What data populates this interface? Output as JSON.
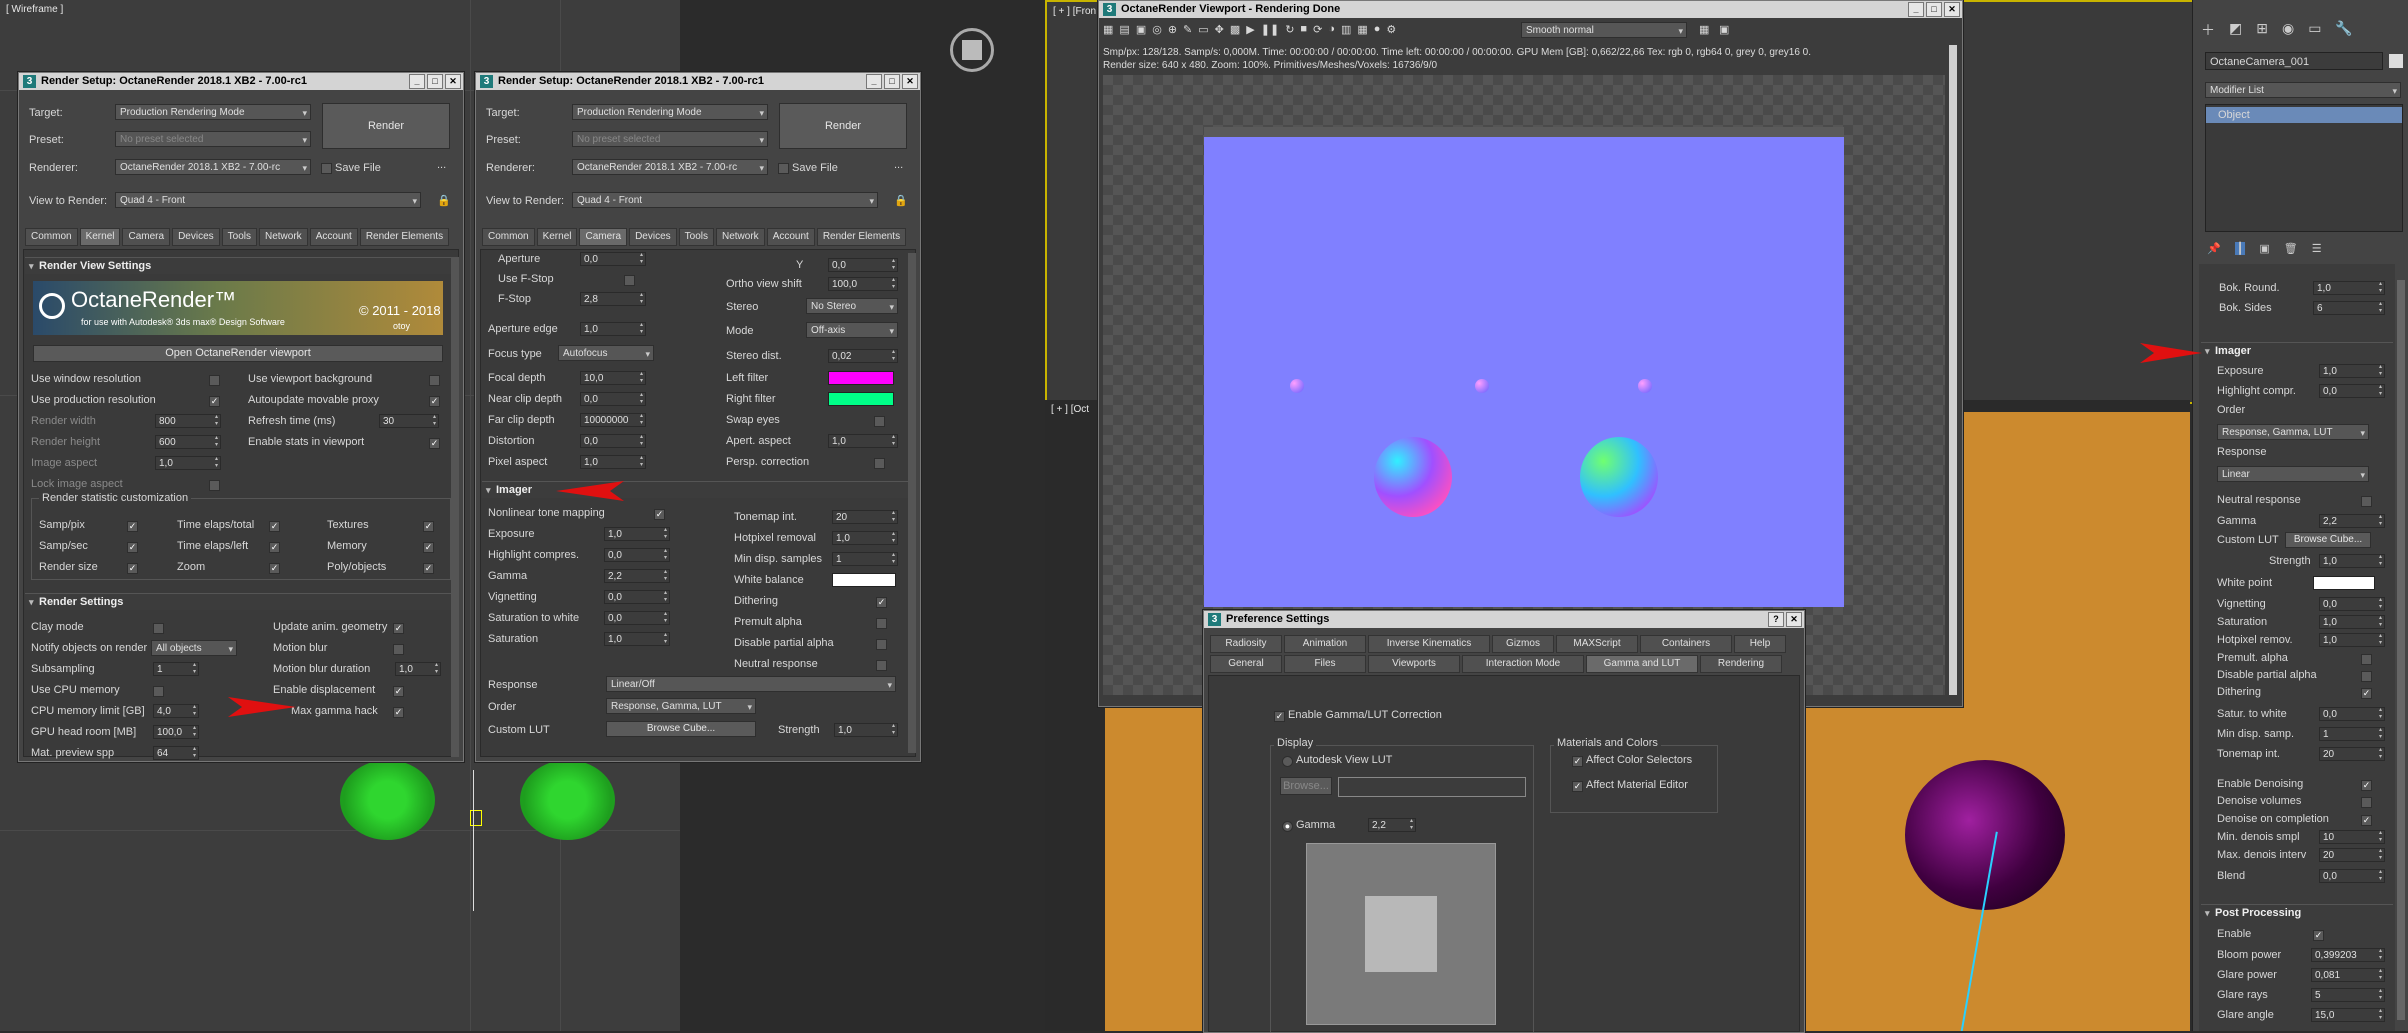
{
  "viewports": {
    "top_left_label": "[ Wireframe ]",
    "right_top_label": "[ + ] [Fron",
    "right_bottom_label": "[ + ] [Oct"
  },
  "render_setup": {
    "title": "Render Setup: OctaneRender 2018.1 XB2 - 7.00-rc1",
    "target_label": "Target:",
    "target_value": "Production Rendering Mode",
    "preset_label": "Preset:",
    "preset_value": "No preset selected",
    "renderer_label": "Renderer:",
    "renderer_value": "OctaneRender 2018.1 XB2 - 7.00-rc",
    "save_file_label": "Save File",
    "view_label": "View to Render:",
    "view_value": "Quad 4 - Front",
    "render_button": "Render",
    "ellipsis": "...",
    "tabs": [
      "Common",
      "Kernel",
      "Camera",
      "Devices",
      "Tools",
      "Network",
      "Account",
      "Render Elements"
    ]
  },
  "left_panel": {
    "render_view_settings": "Render View Settings",
    "banner_title": "OctaneRender™",
    "banner_sub": "for use with Autodesk® 3ds max® Design Software",
    "banner_years": "© 2011 - 2018",
    "banner_brand": "otoy",
    "open_viewport_button": "Open OctaneRender viewport",
    "use_window_resolution": "Use window resolution",
    "use_viewport_background": "Use viewport background",
    "use_production_resolution": "Use production resolution",
    "autoupdate_proxy": "Autoupdate movable proxy",
    "render_width": "Render width",
    "render_width_value": "800",
    "render_height": "Render height",
    "render_height_value": "600",
    "refresh_time": "Refresh time (ms)",
    "refresh_time_value": "30",
    "image_aspect": "Image aspect",
    "image_aspect_value": "1,0",
    "enable_stats": "Enable stats in viewport",
    "lock_image_aspect": "Lock image aspect",
    "stat_group": "Render statistic customization",
    "stats": [
      "Samp/pix",
      "Time elaps/total",
      "Textures",
      "Samp/sec",
      "Time elaps/left",
      "Memory",
      "Render size",
      "Zoom",
      "Poly/objects"
    ],
    "render_settings": "Render Settings",
    "clay_mode": "Clay mode",
    "update_anim": "Update anim. geometry",
    "notify_objects": "Notify objects on render",
    "notify_value": "All objects",
    "motion_blur": "Motion blur",
    "subsampling": "Subsampling",
    "subsampling_value": "1",
    "motion_blur_duration": "Motion blur duration",
    "motion_blur_duration_value": "1,0",
    "use_cpu_memory": "Use CPU memory",
    "enable_displacement": "Enable displacement",
    "cpu_memory_limit": "CPU memory limit [GB]",
    "cpu_memory_limit_value": "4,0",
    "max_gamma_hack": "Max gamma hack",
    "gpu_headroom": "GPU head room [MB]",
    "gpu_headroom_value": "100,0",
    "mat_preview": "Mat. preview spp",
    "mat_preview_value": "64"
  },
  "camera_panel": {
    "aperture": "Aperture",
    "aperture_value": "0,0",
    "use_fstop": "Use F-Stop",
    "fstop": "F-Stop",
    "fstop_value": "2,8",
    "y_label": "Y",
    "y_value": "0,0",
    "ortho_shift": "Ortho view shift",
    "ortho_shift_value": "100,0",
    "stereo": "Stereo",
    "stereo_value": "No Stereo",
    "aperture_edge": "Aperture edge",
    "aperture_edge_value": "1,0",
    "mode": "Mode",
    "mode_value": "Off-axis",
    "focus_type": "Focus type",
    "focus_type_value": "Autofocus",
    "stereo_dist": "Stereo dist.",
    "stereo_dist_value": "0,02",
    "focal_depth": "Focal depth",
    "focal_depth_value": "10,0",
    "left_filter": "Left filter",
    "near_clip": "Near clip depth",
    "near_clip_value": "0,0",
    "right_filter": "Right filter",
    "far_clip": "Far clip depth",
    "far_clip_value": "10000000",
    "swap_eyes": "Swap eyes",
    "distortion": "Distortion",
    "distortion_value": "0,0",
    "apert_aspect": "Apert. aspect",
    "apert_aspect_value": "1,0",
    "pixel_aspect": "Pixel aspect",
    "pixel_aspect_value": "1,0",
    "persp_correction": "Persp. correction",
    "imager": "Imager",
    "nonlinear": "Nonlinear tone mapping",
    "tonemap_int": "Tonemap int.",
    "tonemap_int_value": "20",
    "exposure": "Exposure",
    "exposure_value": "1,0",
    "hotpixel": "Hotpixel removal",
    "hotpixel_value": "1,0",
    "highlight": "Highlight compres.",
    "highlight_value": "0,0",
    "min_disp": "Min disp. samples",
    "min_disp_value": "1",
    "gamma": "Gamma",
    "gamma_value": "2,2",
    "white_balance": "White balance",
    "vignetting": "Vignetting",
    "vignetting_value": "0,0",
    "dithering": "Dithering",
    "sat_white": "Saturation to white",
    "sat_white_value": "0,0",
    "premult": "Premult alpha",
    "saturation": "Saturation",
    "saturation_value": "1,0",
    "disable_partial": "Disable partial alpha",
    "neutral": "Neutral response",
    "response": "Response",
    "response_value": "Linear/Off",
    "order": "Order",
    "order_value": "Response, Gamma, LUT",
    "custom_lut": "Custom LUT",
    "browse_cube": "Browse Cube...",
    "strength": "Strength",
    "strength_value": "1,0",
    "colors": {
      "left_filter": "#ff00ff",
      "right_filter": "#00ff88",
      "white_balance": "#ffffff"
    }
  },
  "octane_viewport": {
    "title": "OctaneRender Viewport - Rendering Done",
    "smooth": "Smooth normal",
    "stats1": "Smp/px: 128/128.   Samp/s: 0,000M.   Time: 00:00:00 / 00:00:00.   Time left: 00:00:00 / 00:00:00.   GPU Mem [GB]: 0,662/22,66   Tex: rgb 0, rgb64 0, grey 0, grey16 0.",
    "stats2": "Render size: 640 x 480.   Zoom: 100%.   Primitives/Meshes/Voxels: 16736/9/0",
    "render_bg": "#8080ff"
  },
  "preferences": {
    "title": "Preference Settings",
    "tabs_row1": [
      "Radiosity",
      "Animation",
      "Inverse Kinematics",
      "Gizmos",
      "MAXScript",
      "Containers",
      "Help"
    ],
    "tabs_row2": [
      "General",
      "Files",
      "Viewports",
      "Interaction Mode",
      "Gamma and LUT",
      "Rendering"
    ],
    "enable_gamma": "Enable Gamma/LUT Correction",
    "display": "Display",
    "autodesk_lut": "Autodesk View LUT",
    "browse": "Browse...",
    "gamma": "Gamma",
    "gamma_value": "2,2",
    "materials_colors": "Materials and Colors",
    "affect_color": "Affect Color Selectors",
    "affect_material": "Affect Material Editor"
  },
  "right_panel": {
    "camera_name": "OctaneCamera_001",
    "modifier_list": "Modifier List",
    "stack_item": "Object",
    "bok_round": "Bok. Round.",
    "bok_round_value": "1,0",
    "bok_sides": "Bok. Sides",
    "bok_sides_value": "6",
    "imager": "Imager",
    "exposure": "Exposure",
    "exposure_value": "1,0",
    "highlight": "Highlight compr.",
    "highlight_value": "0,0",
    "order": "Order",
    "order_value": "Response, Gamma, LUT",
    "response": "Response",
    "response_value": "Linear",
    "neutral": "Neutral response",
    "gamma": "Gamma",
    "gamma_value": "2,2",
    "custom_lut": "Custom LUT",
    "browse_cube": "Browse Cube...",
    "strength": "Strength",
    "strength_value": "1,0",
    "white_point": "White point",
    "vignetting": "Vignetting",
    "vignetting_value": "0,0",
    "saturation": "Saturation",
    "saturation_value": "1,0",
    "hotpixel": "Hotpixel remov.",
    "hotpixel_value": "1,0",
    "premult": "Premult. alpha",
    "disable_partial": "Disable partial alpha",
    "dithering": "Dithering",
    "satur_white": "Satur. to white",
    "satur_white_value": "0,0",
    "min_disp": "Min disp. samp.",
    "min_disp_value": "1",
    "tonemap": "Tonemap int.",
    "tonemap_value": "20",
    "enable_denoising": "Enable Denoising",
    "denoise_volumes": "Denoise volumes",
    "denoise_completion": "Denoise on completion",
    "min_denois": "Min. denois smpl",
    "min_denois_value": "10",
    "max_denois": "Max. denois interv",
    "max_denois_value": "20",
    "blend": "Blend",
    "blend_value": "0,0",
    "post_processing": "Post Processing",
    "enable": "Enable",
    "bloom": "Bloom power",
    "bloom_value": "0,399203",
    "glare": "Glare power",
    "glare_value": "0,081",
    "glare_rays": "Glare rays",
    "glare_rays_value": "5",
    "glare_angle": "Glare angle",
    "glare_angle_value": "15,0"
  }
}
